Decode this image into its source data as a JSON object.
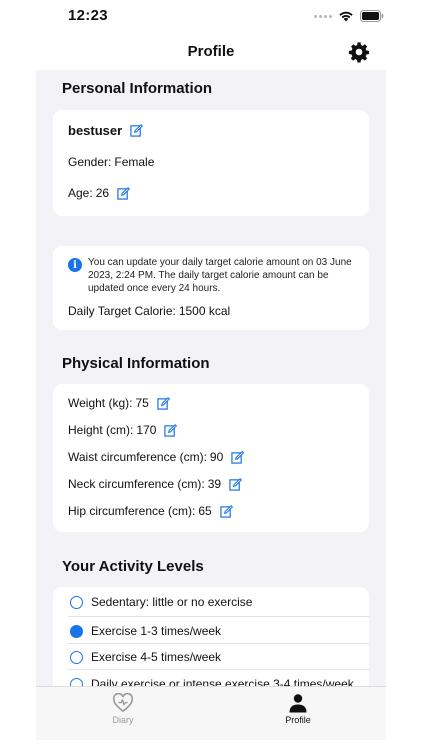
{
  "status_bar": {
    "time": "12:23"
  },
  "nav": {
    "title": "Profile"
  },
  "personal": {
    "section_title": "Personal Information",
    "username": "bestuser",
    "gender_label": "Gender:",
    "gender_value": "Female",
    "age_label": "Age:",
    "age_value": "26"
  },
  "calorie": {
    "notice": "You can update your daily target calorie amount on 03 June 2023, 2:24 PM. The daily target calorie amount can be updated once every 24 hours.",
    "label": "Daily Target Calorie:",
    "value": "1500 kcal"
  },
  "physical": {
    "section_title": "Physical Information",
    "items": [
      {
        "label": "Weight (kg):",
        "value": "75"
      },
      {
        "label": "Height (cm):",
        "value": "170"
      },
      {
        "label": "Waist circumference (cm):",
        "value": "90"
      },
      {
        "label": "Neck circumference (cm):",
        "value": "39"
      },
      {
        "label": "Hip circumference (cm):",
        "value": "65"
      }
    ]
  },
  "activity": {
    "section_title": "Your Activity Levels",
    "options": [
      {
        "label": "Sedentary: little or no exercise",
        "selected": false
      },
      {
        "label": "Exercise 1-3 times/week",
        "selected": true
      },
      {
        "label": "Exercise 4-5 times/week",
        "selected": false
      },
      {
        "label": "Daily exercise or intense exercise 3-4 times/week",
        "selected": false
      }
    ]
  },
  "tab_bar": {
    "tabs": [
      {
        "label": "Diary",
        "icon": "heart-pulse-icon",
        "active": false
      },
      {
        "label": "Profile",
        "icon": "person-icon",
        "active": true
      }
    ]
  },
  "colors": {
    "accent": "#1a73e8",
    "background": "#f2f2f7"
  }
}
